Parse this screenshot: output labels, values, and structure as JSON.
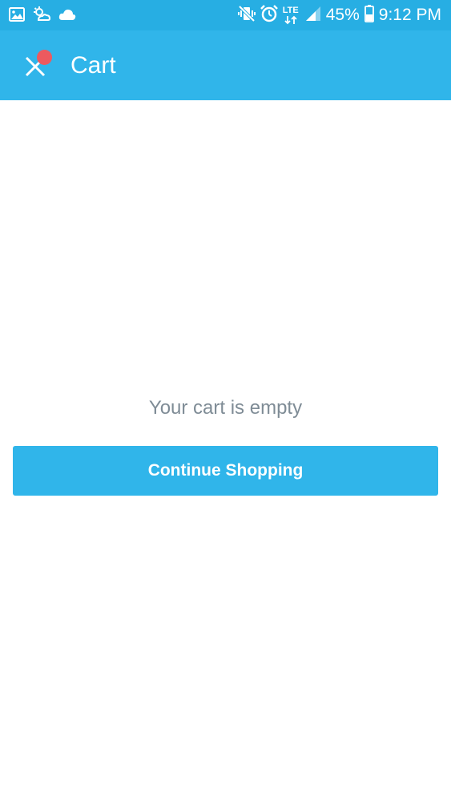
{
  "status_bar": {
    "left_icons": [
      "image-icon",
      "weather-icon",
      "cloud-icon"
    ],
    "right_icons": [
      "vibrate-icon",
      "alarm-icon",
      "lte-icon",
      "signal-icon",
      "battery-icon"
    ],
    "lte_label": "LTE",
    "battery_percent": "45%",
    "time": "9:12 PM",
    "background_color": "#27aee3"
  },
  "app_bar": {
    "close_icon": "close-icon",
    "title": "Cart",
    "background_color": "#30b5ea",
    "badge_color": "#ec5a5f"
  },
  "main": {
    "empty_message": "Your cart is empty",
    "continue_button_label": "Continue Shopping",
    "message_color": "#7f8c96"
  }
}
